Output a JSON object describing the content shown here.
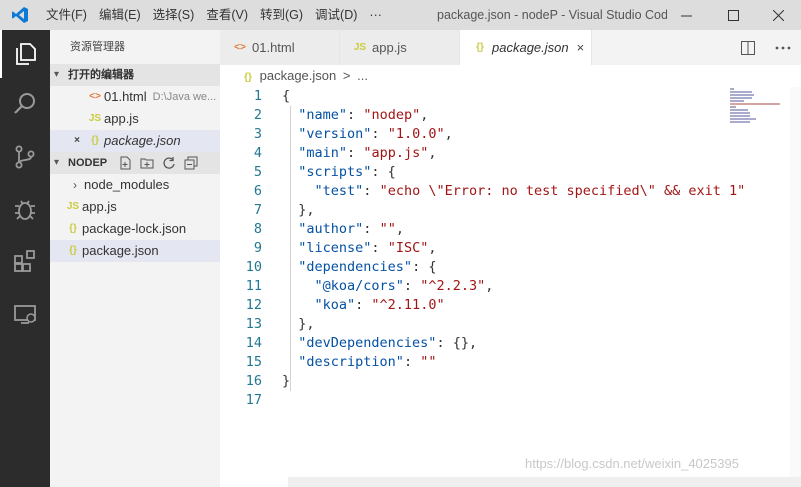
{
  "titlebar": {
    "menu": [
      "文件(F)",
      "编辑(E)",
      "选择(S)",
      "查看(V)",
      "转到(G)",
      "调试(D)",
      "···"
    ],
    "window_title": "package.json - nodeP - Visual Studio Cod..."
  },
  "sidebar": {
    "title": "资源管理器",
    "open_editors": {
      "header": "打开的编辑器",
      "items": [
        {
          "icon": "<>",
          "label": "01.html",
          "path": "D:\\Java we..."
        },
        {
          "icon": "JS",
          "label": "app.js"
        },
        {
          "icon": "{}",
          "label": "package.json"
        }
      ]
    },
    "project": {
      "header": "NODEP",
      "items": [
        {
          "label": "node_modules"
        },
        {
          "icon": "JS",
          "label": "app.js"
        },
        {
          "icon": "{}",
          "label": "package-lock.json"
        },
        {
          "icon": "{}",
          "label": "package.json"
        }
      ]
    }
  },
  "tabs": [
    {
      "icon": "<>",
      "label": "01.html"
    },
    {
      "icon": "JS",
      "label": "app.js"
    },
    {
      "icon": "{}",
      "label": "package.json",
      "close": "×"
    }
  ],
  "breadcrumb": {
    "icon": "{}",
    "file": "package.json",
    "sep": ">",
    "rest": "..."
  },
  "editor": {
    "line_numbers": [
      "1",
      "2",
      "3",
      "4",
      "5",
      "6",
      "7",
      "8",
      "9",
      "10",
      "11",
      "12",
      "13",
      "14",
      "15",
      "16",
      "17"
    ],
    "lines": [
      [
        [
          "p",
          "{"
        ]
      ],
      [
        [
          "p",
          "  "
        ],
        [
          "k",
          "\"name\""
        ],
        [
          "p",
          ": "
        ],
        [
          "s",
          "\"nodep\""
        ],
        [
          "p",
          ","
        ]
      ],
      [
        [
          "p",
          "  "
        ],
        [
          "k",
          "\"version\""
        ],
        [
          "p",
          ": "
        ],
        [
          "s",
          "\"1.0.0\""
        ],
        [
          "p",
          ","
        ]
      ],
      [
        [
          "p",
          "  "
        ],
        [
          "k",
          "\"main\""
        ],
        [
          "p",
          ": "
        ],
        [
          "s",
          "\"app.js\""
        ],
        [
          "p",
          ","
        ]
      ],
      [
        [
          "p",
          "  "
        ],
        [
          "k",
          "\"scripts\""
        ],
        [
          "p",
          ": {"
        ]
      ],
      [
        [
          "p",
          "    "
        ],
        [
          "k",
          "\"test\""
        ],
        [
          "p",
          ": "
        ],
        [
          "s",
          "\"echo \\\"Error: no test specified\\\" && exit 1\""
        ]
      ],
      [
        [
          "p",
          "  },"
        ]
      ],
      [
        [
          "p",
          "  "
        ],
        [
          "k",
          "\"author\""
        ],
        [
          "p",
          ": "
        ],
        [
          "s",
          "\"\""
        ],
        [
          "p",
          ","
        ]
      ],
      [
        [
          "p",
          "  "
        ],
        [
          "k",
          "\"license\""
        ],
        [
          "p",
          ": "
        ],
        [
          "s",
          "\"ISC\""
        ],
        [
          "p",
          ","
        ]
      ],
      [
        [
          "p",
          "  "
        ],
        [
          "k",
          "\"dependencies\""
        ],
        [
          "p",
          ": {"
        ]
      ],
      [
        [
          "p",
          "    "
        ],
        [
          "k",
          "\"@koa/cors\""
        ],
        [
          "p",
          ": "
        ],
        [
          "s",
          "\"^2.2.3\""
        ],
        [
          "p",
          ","
        ]
      ],
      [
        [
          "p",
          "    "
        ],
        [
          "k",
          "\"koa\""
        ],
        [
          "p",
          ": "
        ],
        [
          "s",
          "\"^2.11.0\""
        ]
      ],
      [
        [
          "p",
          "  },"
        ]
      ],
      [
        [
          "p",
          "  "
        ],
        [
          "k",
          "\"devDependencies\""
        ],
        [
          "p",
          ": {},"
        ]
      ],
      [
        [
          "p",
          "  "
        ],
        [
          "k",
          "\"description\""
        ],
        [
          "p",
          ": "
        ],
        [
          "s",
          "\"\""
        ]
      ],
      [
        [
          "p",
          "}"
        ]
      ],
      [
        [
          "p",
          ""
        ]
      ]
    ]
  },
  "watermark": "https://blog.csdn.net/weixin_4025395",
  "colors": {
    "activity_bar": "#2c2c2c",
    "key": "#0451a5",
    "string": "#a31515",
    "line_number": "#237893"
  }
}
